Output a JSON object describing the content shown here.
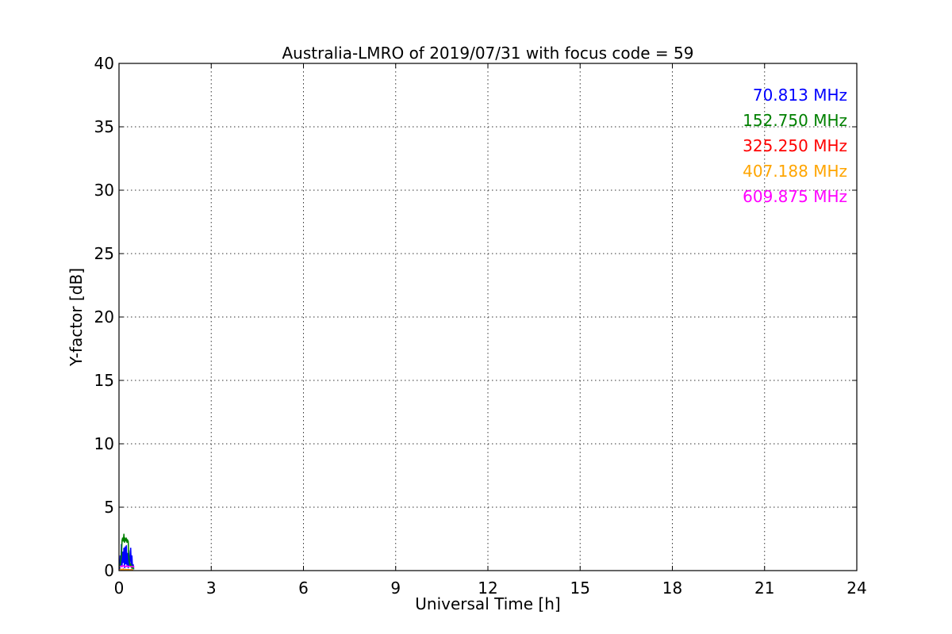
{
  "chart_data": {
    "type": "line",
    "title": "Australia-LMRO of 2019/07/31 with focus code = 59",
    "xlabel": "Universal Time [h]",
    "ylabel": "Y-factor [dB]",
    "xlim": [
      0,
      24
    ],
    "ylim": [
      0,
      40
    ],
    "xticks": [
      0,
      3,
      6,
      9,
      12,
      15,
      18,
      21,
      24
    ],
    "yticks": [
      0,
      5,
      10,
      15,
      20,
      25,
      30,
      35,
      40
    ],
    "grid": true,
    "legend": "top-right",
    "series": [
      {
        "name": "70.813 MHz",
        "color": "#0000ff",
        "x": [
          0.02,
          0.04,
          0.06,
          0.08,
          0.1,
          0.12,
          0.14,
          0.16,
          0.18,
          0.2,
          0.22,
          0.24,
          0.26,
          0.28,
          0.3,
          0.32,
          0.34,
          0.36,
          0.38,
          0.4,
          0.42,
          0.44,
          0.46,
          0.48
        ],
        "y": [
          0.1,
          1.2,
          0.3,
          2.1,
          0.4,
          1.5,
          0.6,
          1.8,
          0.2,
          1.9,
          0.5,
          2.0,
          0.3,
          1.4,
          0.2,
          1.6,
          0.3,
          0.9,
          1.8,
          0.4,
          1.2,
          0.2,
          0.5,
          0.1
        ]
      },
      {
        "name": "152.750 MHz",
        "color": "#008000",
        "x": [
          0.02,
          0.04,
          0.06,
          0.08,
          0.1,
          0.12,
          0.14,
          0.16,
          0.18,
          0.2,
          0.22,
          0.24,
          0.26,
          0.28,
          0.3,
          0.32,
          0.34,
          0.36,
          0.38,
          0.4,
          0.42,
          0.44,
          0.46,
          0.48
        ],
        "y": [
          0.2,
          0.5,
          0.9,
          1.2,
          2.4,
          2.6,
          2.3,
          2.9,
          2.2,
          2.6,
          2.4,
          2.5,
          2.2,
          2.4,
          2.3,
          1.0,
          0.6,
          0.4,
          0.5,
          0.3,
          0.2,
          0.4,
          0.2,
          0.1
        ]
      },
      {
        "name": "325.250 MHz",
        "color": "#ff0000",
        "x": [
          0.02,
          0.06,
          0.1,
          0.14,
          0.18,
          0.22,
          0.26,
          0.3,
          0.34,
          0.38,
          0.42,
          0.46
        ],
        "y": [
          0.05,
          0.1,
          0.08,
          0.12,
          0.06,
          0.1,
          0.07,
          0.09,
          0.05,
          0.08,
          0.06,
          0.04
        ]
      },
      {
        "name": "407.188 MHz",
        "color": "#ffa500",
        "x": [
          0.02,
          0.06,
          0.1,
          0.14,
          0.18,
          0.22,
          0.26,
          0.3,
          0.34,
          0.38,
          0.42,
          0.46
        ],
        "y": [
          0.05,
          0.08,
          0.1,
          0.07,
          0.09,
          0.06,
          0.08,
          0.05,
          0.07,
          0.06,
          0.05,
          0.04
        ]
      },
      {
        "name": "609.875 MHz",
        "color": "#ff00ff",
        "x": [
          0.02,
          0.06,
          0.1,
          0.14,
          0.18,
          0.22,
          0.26,
          0.3,
          0.34,
          0.38,
          0.42,
          0.46,
          0.5
        ],
        "y": [
          0.3,
          0.35,
          0.3,
          0.4,
          0.35,
          0.3,
          0.38,
          0.32,
          0.35,
          0.3,
          0.33,
          0.3,
          0.3
        ]
      }
    ]
  }
}
